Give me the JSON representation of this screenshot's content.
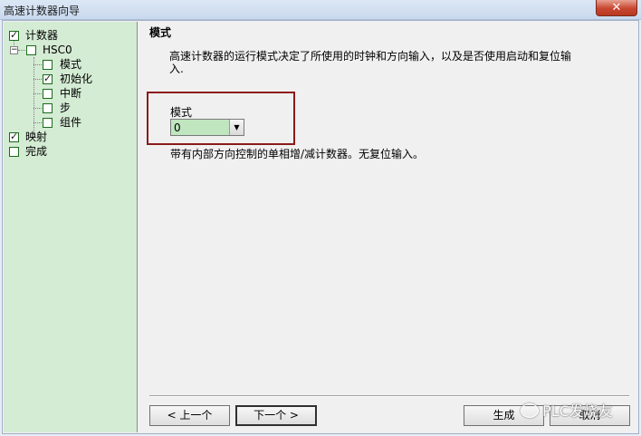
{
  "window": {
    "title": "高速计数器向导",
    "close_icon": "✕"
  },
  "tree": {
    "items": [
      {
        "label": "计数器",
        "checked": true
      },
      {
        "label": "HSC0",
        "checked": false
      },
      {
        "label": "模式",
        "checked": false
      },
      {
        "label": "初始化",
        "checked": true
      },
      {
        "label": "中断",
        "checked": false
      },
      {
        "label": "步",
        "checked": false
      },
      {
        "label": "组件",
        "checked": false
      },
      {
        "label": "映射",
        "checked": true
      },
      {
        "label": "完成",
        "checked": false
      }
    ],
    "expander_symbol": "−"
  },
  "main": {
    "section_title": "模式",
    "description": "高速计数器的运行模式决定了所使用的时钟和方向输入，以及是否使用启动和复位输入.",
    "mode_label": "模式",
    "mode_value": "0",
    "mode_note": "带有内部方向控制的单相增/减计数器。无复位输入。"
  },
  "buttons": {
    "prev": "< 上一个",
    "next": "下一个 >",
    "generate": "生成",
    "cancel": "取消"
  },
  "watermark": "PLC发烧友",
  "colors": {
    "tree_bg": "#d4ebd4",
    "select_bg": "#bfe6bf",
    "highlight": "#8b1a1a"
  }
}
